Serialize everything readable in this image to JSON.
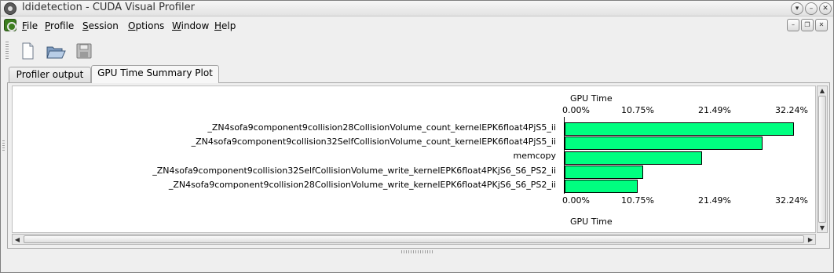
{
  "window": {
    "title": "ldidetection - CUDA Visual Profiler"
  },
  "menu": {
    "items": [
      {
        "label": "File",
        "mnemonic": "F",
        "rest": "ile"
      },
      {
        "label": "Profile",
        "mnemonic": "P",
        "rest": "rofile"
      },
      {
        "label": "Session",
        "mnemonic": "S",
        "rest": "ession"
      },
      {
        "label": "Options",
        "mnemonic": "O",
        "rest": "ptions"
      },
      {
        "label": "Window",
        "mnemonic": "W",
        "rest": "indow"
      },
      {
        "label": "Help",
        "mnemonic": "H",
        "rest": "elp"
      }
    ]
  },
  "toolbar": {
    "icons": [
      "new-file-icon",
      "open-folder-icon",
      "save-disk-icon"
    ]
  },
  "tabs": [
    {
      "label": "Profiler output",
      "active": false
    },
    {
      "label": "GPU Time Summary Plot",
      "active": true
    }
  ],
  "chart_data": {
    "type": "bar",
    "orientation": "horizontal",
    "title_top": "GPU Time",
    "title_bottom": "GPU Time",
    "ticks": [
      "0.00%",
      "10.75%",
      "21.49%",
      "32.24%"
    ],
    "xlim": [
      0,
      32.24
    ],
    "categories": [
      "_ZN4sofa9component9collision28CollisionVolume_count_kernelEPK6float4PjS5_ii",
      "_ZN4sofa9component9collision32SelfCollisionVolume_count_kernelEPK6float4PjS5_ii",
      "memcopy",
      "_ZN4sofa9component9collision32SelfCollisionVolume_write_kernelEPK6float4PKjS6_S6_PS2_ii",
      "_ZN4sofa9component9collision28CollisionVolume_write_kernelEPK6float4PKjS6_S6_PS2_ii"
    ],
    "values": [
      32.2,
      27.8,
      19.3,
      11.0,
      10.3
    ],
    "bar_color": "#00ff80"
  }
}
